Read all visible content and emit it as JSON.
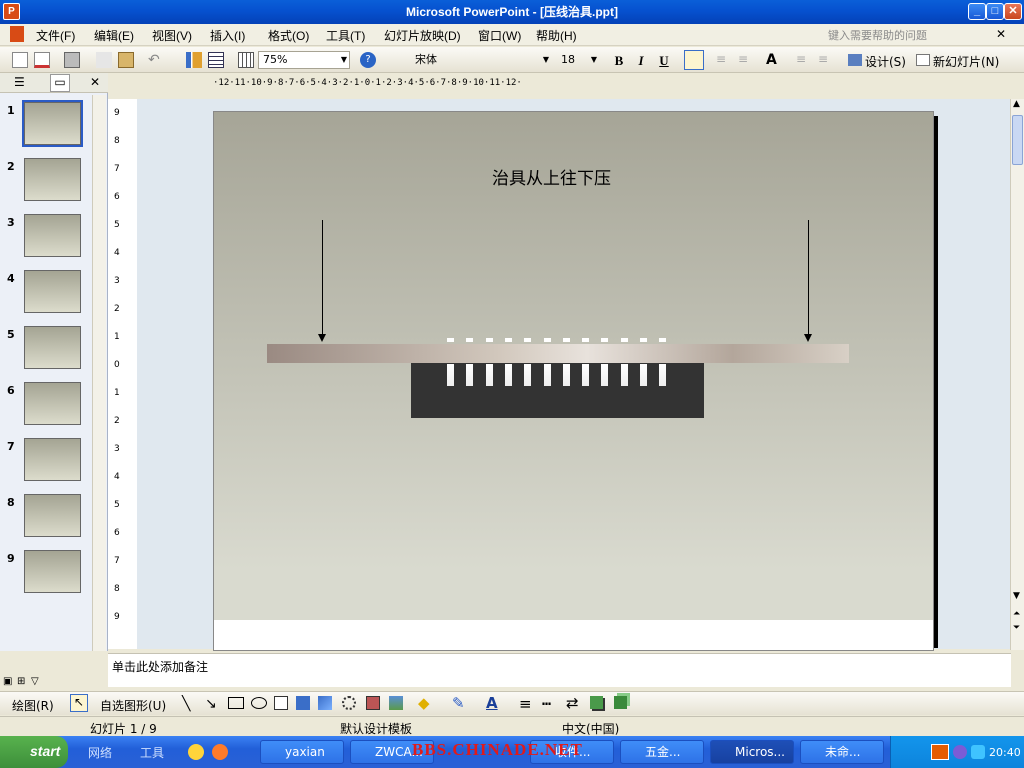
{
  "window": {
    "title": "Microsoft PowerPoint - [压线治具.ppt]"
  },
  "menu": [
    "文件(F)",
    "编辑(E)",
    "视图(V)",
    "插入(I)",
    "格式(O)",
    "工具(T)",
    "幻灯片放映(D)",
    "窗口(W)",
    "帮助(H)"
  ],
  "help_placeholder": "键入需要帮助的问题",
  "toolbar": {
    "zoom": "75%",
    "font": "宋体",
    "size": "18",
    "bold": "B",
    "italic": "I",
    "underline": "U",
    "design": "设计(S)",
    "new_slide": "新幻灯片(N)"
  },
  "ruler_h": "·12·11·10·9·8·7·6·5·4·3·2·1·0·1·2·3·4·5·6·7·8·9·10·11·12·",
  "ruler_v": [
    "9",
    "8",
    "7",
    "6",
    "5",
    "4",
    "3",
    "2",
    "1",
    "0",
    "1",
    "2",
    "3",
    "4",
    "5",
    "6",
    "7",
    "8",
    "9"
  ],
  "slides": [
    "1",
    "2",
    "3",
    "4",
    "5",
    "6",
    "7",
    "8",
    "9"
  ],
  "slide": {
    "title": "治具从上往下压"
  },
  "notes": {
    "placeholder": "单击此处添加备注"
  },
  "drawing": {
    "draw": "绘图(R)",
    "autoshapes": "自选图形(U)"
  },
  "status": {
    "slide": "幻灯片 1 / 9",
    "template": "默认设计模板",
    "language": "中文(中国)"
  },
  "taskbar": {
    "start": "start",
    "quick": [
      "网络",
      "工具"
    ],
    "tasks": [
      "yaxian",
      "ZWCA...",
      "收件...",
      "五金...",
      "Micros...",
      "未命..."
    ],
    "watermark": "BBS.CHINADE.NET",
    "clock": "20:40"
  }
}
